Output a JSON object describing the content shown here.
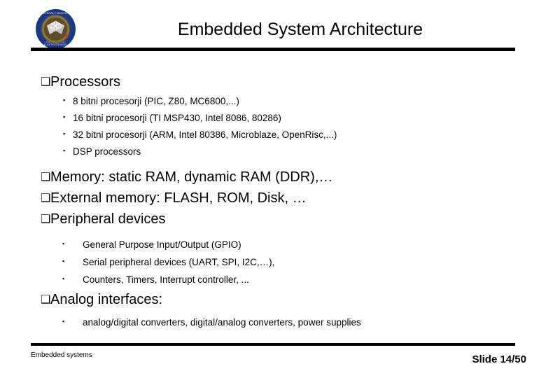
{
  "slide": {
    "title": "Embedded System Architecture",
    "logo": {
      "icon": "university-seal-icon",
      "ring_text_top": "UNIVERZA V MARIBORU",
      "ring_text_bottom": "FAKULTETA ZA ELEKTROTEHNIKO",
      "colors": {
        "ring": "#1b3a8c",
        "inner": "#8b7436",
        "accent": "#c0392b"
      }
    },
    "blocks": [
      {
        "bullet": "❑",
        "text": "Processors",
        "sub_bullet": "▪",
        "sub_items": [
          "8 bitni procesorji (PIC, Z80, MC6800,...)",
          "16 bitni procesorji (TI MSP430, Intel 8086, 80286)",
          "32 bitni procesorji (ARM, Intel 80386, Microblaze, OpenRisc,...)",
          "DSP processors"
        ]
      },
      {
        "bullet": "❑",
        "text": "Memory: static RAM, dynamic RAM (DDR),…",
        "sub_items": []
      },
      {
        "bullet": "❑",
        "text": "External memory: FLASH, ROM, Disk, …",
        "sub_items": []
      },
      {
        "bullet": "❑",
        "text": "Peripheral devices",
        "sub_bullet": "▪",
        "sub_items": [
          "General Purpose Input/Output (GPIO)",
          "Serial peripheral devices (UART, SPI, I2C,…),",
          "Counters, Timers, Interrupt controller, ..."
        ]
      },
      {
        "bullet": "❑",
        "text": "Analog interfaces:",
        "sub_bullet": "▪",
        "sub_items": [
          "analog/digital converters,  digital/analog converters, power supplies"
        ]
      }
    ],
    "footer": {
      "left": "Embedded systems",
      "right": "Slide 14/50"
    }
  }
}
